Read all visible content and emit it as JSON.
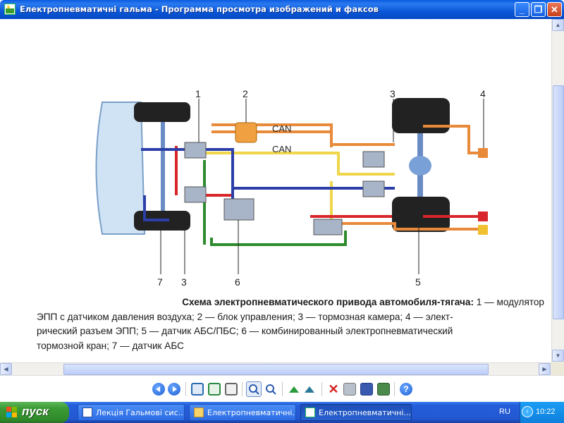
{
  "window": {
    "title": "Електропневматичні гальма - Программа просмотра изображений и факсов",
    "minimize": "_",
    "maximize": "❐",
    "close": "✕"
  },
  "diagram": {
    "callouts": [
      "1",
      "2",
      "3",
      "4",
      "7",
      "3",
      "6",
      "5"
    ],
    "can_labels": [
      "CAN",
      "CAN"
    ]
  },
  "caption": {
    "bold": "Схема электропневматического привода автомобиля-тягача:",
    "line1_rest": " 1 — модулятор",
    "line2": "ЭПП с датчиком давления воздуха; 2 — блок управления; 3 — тормозная камера; 4 — элект-",
    "line3": "рический разъем ЭПП; 5 — датчик АБС/ПБС; 6 — комбинированный электропневматический",
    "line4": "тормозной кран; 7 — датчик АБС"
  },
  "taskbar": {
    "start_label": "пуск",
    "tasks": [
      {
        "label": "Лекція Гальмові сис..."
      },
      {
        "label": "Електропневматичні..."
      },
      {
        "label": "Електропневматичні..."
      }
    ],
    "language": "RU",
    "clock": "10:22"
  },
  "colors": {
    "title_blue": "#0a58d8",
    "taskbar_blue": "#245edb",
    "start_green": "#3c9b36",
    "pipe_orange": "#e88a3a",
    "pipe_red": "#d8262a",
    "pipe_blue": "#2c3fa8",
    "pipe_yellow": "#f0d64a",
    "pipe_green": "#2d8a2d"
  }
}
